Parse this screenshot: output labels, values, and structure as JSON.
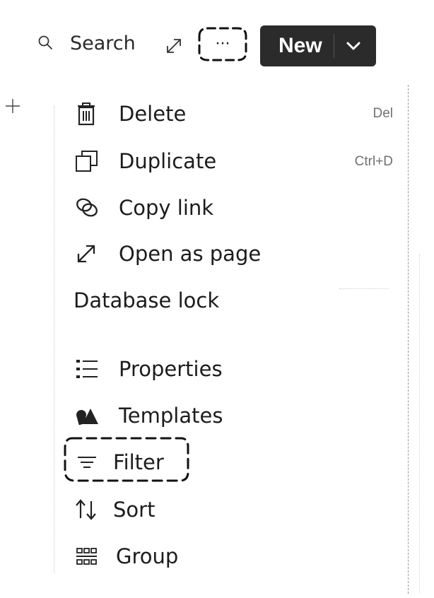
{
  "toolbar": {
    "search_label": "Search",
    "search_icon": "search-icon",
    "expand_icon": "expand-diagonal-icon",
    "more_label": "···",
    "new_label": "New",
    "new_chevron": "chevron-down-icon"
  },
  "gutter": {
    "add_icon": "plus-icon"
  },
  "menu": {
    "items": [
      {
        "label": "Delete",
        "icon": "trash-icon",
        "shortcut": "Del"
      },
      {
        "label": "Duplicate",
        "icon": "duplicate-icon",
        "shortcut": "Ctrl+D"
      },
      {
        "label": "Copy link",
        "icon": "link-icon",
        "shortcut": ""
      },
      {
        "label": "Open as page",
        "icon": "open-diagonal-icon",
        "shortcut": ""
      },
      {
        "label": "Database lock",
        "icon": "",
        "shortcut": ""
      },
      {
        "label": "Properties",
        "icon": "list-icon",
        "shortcut": ""
      },
      {
        "label": "Templates",
        "icon": "shapes-icon",
        "shortcut": ""
      },
      {
        "label": "Filter",
        "icon": "filter-icon",
        "shortcut": "",
        "highlighted": true
      },
      {
        "label": "Sort",
        "icon": "sort-arrows-icon",
        "shortcut": ""
      },
      {
        "label": "Group",
        "icon": "group-grid-icon",
        "shortcut": ""
      }
    ]
  },
  "colors": {
    "new_button_bg": "#2b2b2b",
    "text": "#1c1c1c",
    "shortcut_text": "#707070",
    "highlight_dash": "#222222"
  }
}
